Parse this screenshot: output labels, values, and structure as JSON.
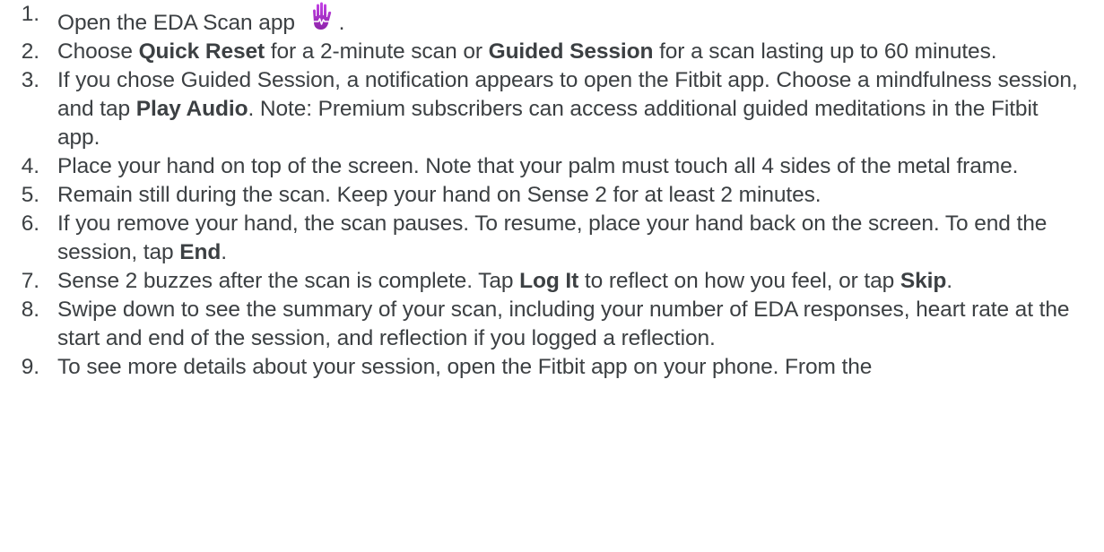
{
  "steps": [
    {
      "number": "1.",
      "parts": [
        {
          "text": "Open the EDA Scan app ",
          "bold": false
        }
      ],
      "icon": "eda-scan-hand-icon",
      "after_icon": "."
    },
    {
      "number": "2.",
      "parts": [
        {
          "text": "Choose ",
          "bold": false
        },
        {
          "text": "Quick Reset",
          "bold": true
        },
        {
          "text": " for a 2-minute scan or ",
          "bold": false
        },
        {
          "text": "Guided Session",
          "bold": true
        },
        {
          "text": " for a scan lasting up to 60 minutes.",
          "bold": false
        }
      ]
    },
    {
      "number": "3.",
      "parts": [
        {
          "text": "If you chose Guided Session, a notification appears to open the Fitbit app. Choose a mindfulness session, and tap ",
          "bold": false
        },
        {
          "text": "Play Audio",
          "bold": true
        },
        {
          "text": ". Note: Premium subscribers can access additional guided meditations in the Fitbit app.",
          "bold": false
        }
      ]
    },
    {
      "number": "4.",
      "parts": [
        {
          "text": "Place your hand on top of the screen. Note that your palm must touch all 4 sides of the metal frame.",
          "bold": false
        }
      ]
    },
    {
      "number": "5.",
      "parts": [
        {
          "text": "Remain still during the scan. Keep your hand on Sense 2 for at least 2 minutes.",
          "bold": false
        }
      ]
    },
    {
      "number": "6.",
      "parts": [
        {
          "text": "If you remove your hand, the scan pauses. To resume, place your hand back on the screen. To end the session, tap ",
          "bold": false
        },
        {
          "text": "End",
          "bold": true
        },
        {
          "text": ".",
          "bold": false
        }
      ]
    },
    {
      "number": "7.",
      "parts": [
        {
          "text": "Sense 2 buzzes after the scan is complete. Tap ",
          "bold": false
        },
        {
          "text": "Log It",
          "bold": true
        },
        {
          "text": " to reflect on how you feel, or tap ",
          "bold": false
        },
        {
          "text": "Skip",
          "bold": true
        },
        {
          "text": ".",
          "bold": false
        }
      ]
    },
    {
      "number": "8.",
      "parts": [
        {
          "text": "Swipe down to see the summary of your scan, including your number of EDA responses, heart rate at the start and end of the session, and reflection if you logged a reflection.",
          "bold": false
        }
      ]
    },
    {
      "number": "9.",
      "parts": [
        {
          "text": "To see more details about your session, open the Fitbit app on your phone. From the",
          "bold": false
        }
      ]
    }
  ],
  "colors": {
    "text": "#3c4043",
    "icon_gradient_top": "#c542e8",
    "icon_gradient_bottom": "#8e24aa"
  }
}
